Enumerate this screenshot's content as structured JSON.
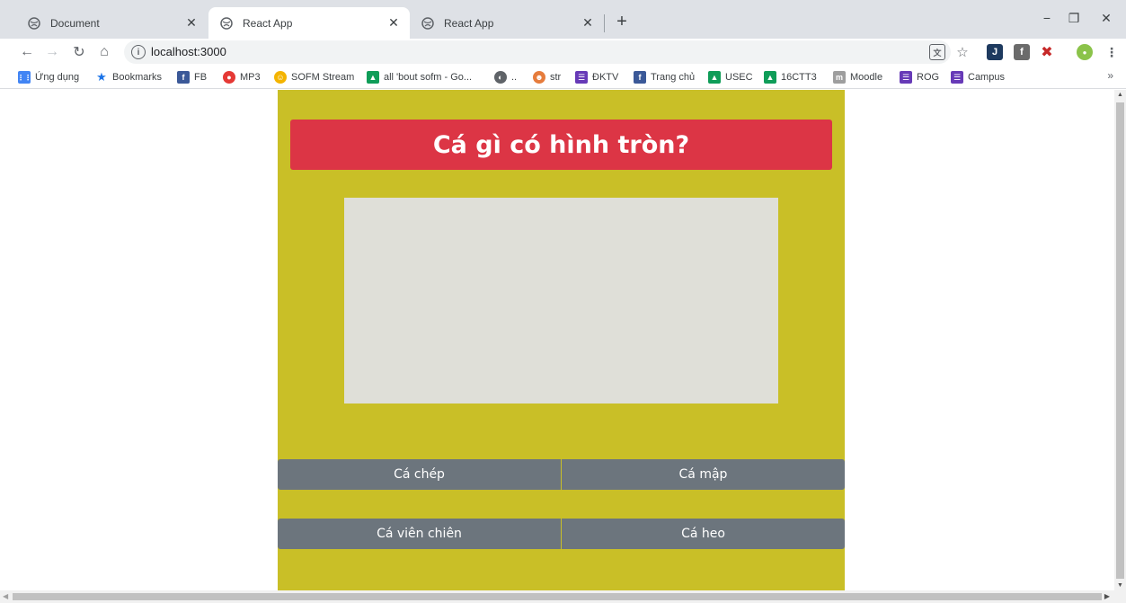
{
  "browser": {
    "tabs": [
      {
        "title": "Document",
        "icon": "globe-icon",
        "active": false
      },
      {
        "title": "React App",
        "icon": "globe-icon",
        "active": true
      },
      {
        "title": "React App",
        "icon": "globe-icon",
        "active": false
      }
    ],
    "new_tab_icon": "+",
    "window_controls": {
      "minimize": "−",
      "restore": "❐",
      "close": "✕"
    },
    "url": "localhost:3000",
    "nav": {
      "back": "←",
      "forward": "→",
      "reload": "↻",
      "home": "⌂"
    },
    "bookmarks": [
      {
        "label": "Ứng dụng",
        "icon": "apps-icon",
        "color": "#4285f4"
      },
      {
        "label": "Bookmarks",
        "icon": "star-icon",
        "color": "#1a73e8"
      },
      {
        "label": "FB",
        "icon": "facebook-icon",
        "color": "#3b5998"
      },
      {
        "label": "MP3",
        "icon": "mp3-icon",
        "color": "#e53935"
      },
      {
        "label": "SOFM Stream",
        "icon": "sofm-icon",
        "color": "#f4b400"
      },
      {
        "label": "all 'bout sofm - Go...",
        "icon": "drive-icon",
        "color": "#0f9d58"
      },
      {
        "label": "..",
        "icon": "globe-icon",
        "color": "#5f6368"
      },
      {
        "label": "str",
        "icon": "avatar-icon",
        "color": "#e67c3c"
      },
      {
        "label": "ĐKTV",
        "icon": "list-icon",
        "color": "#673ab7"
      },
      {
        "label": "Trang chủ",
        "icon": "facebook-icon",
        "color": "#3b5998"
      },
      {
        "label": "USEC",
        "icon": "drive-icon",
        "color": "#0f9d58"
      },
      {
        "label": "16CTT3",
        "icon": "drive-icon",
        "color": "#0f9d58"
      },
      {
        "label": "Moodle",
        "icon": "moodle-icon",
        "color": "#9e9e9e"
      },
      {
        "label": "ROG",
        "icon": "list-icon",
        "color": "#673ab7"
      },
      {
        "label": "Campus",
        "icon": "list-icon",
        "color": "#673ab7"
      }
    ],
    "bookmarks_more": "»"
  },
  "quiz": {
    "question": "Cá gì có hình tròn?",
    "answers": [
      "Cá chép",
      "Cá mập",
      "Cá viên chiên",
      "Cá heo"
    ]
  },
  "colors": {
    "page_background": "#c9bf27",
    "question_background": "#dc3545",
    "answer_background": "#6c757d"
  }
}
